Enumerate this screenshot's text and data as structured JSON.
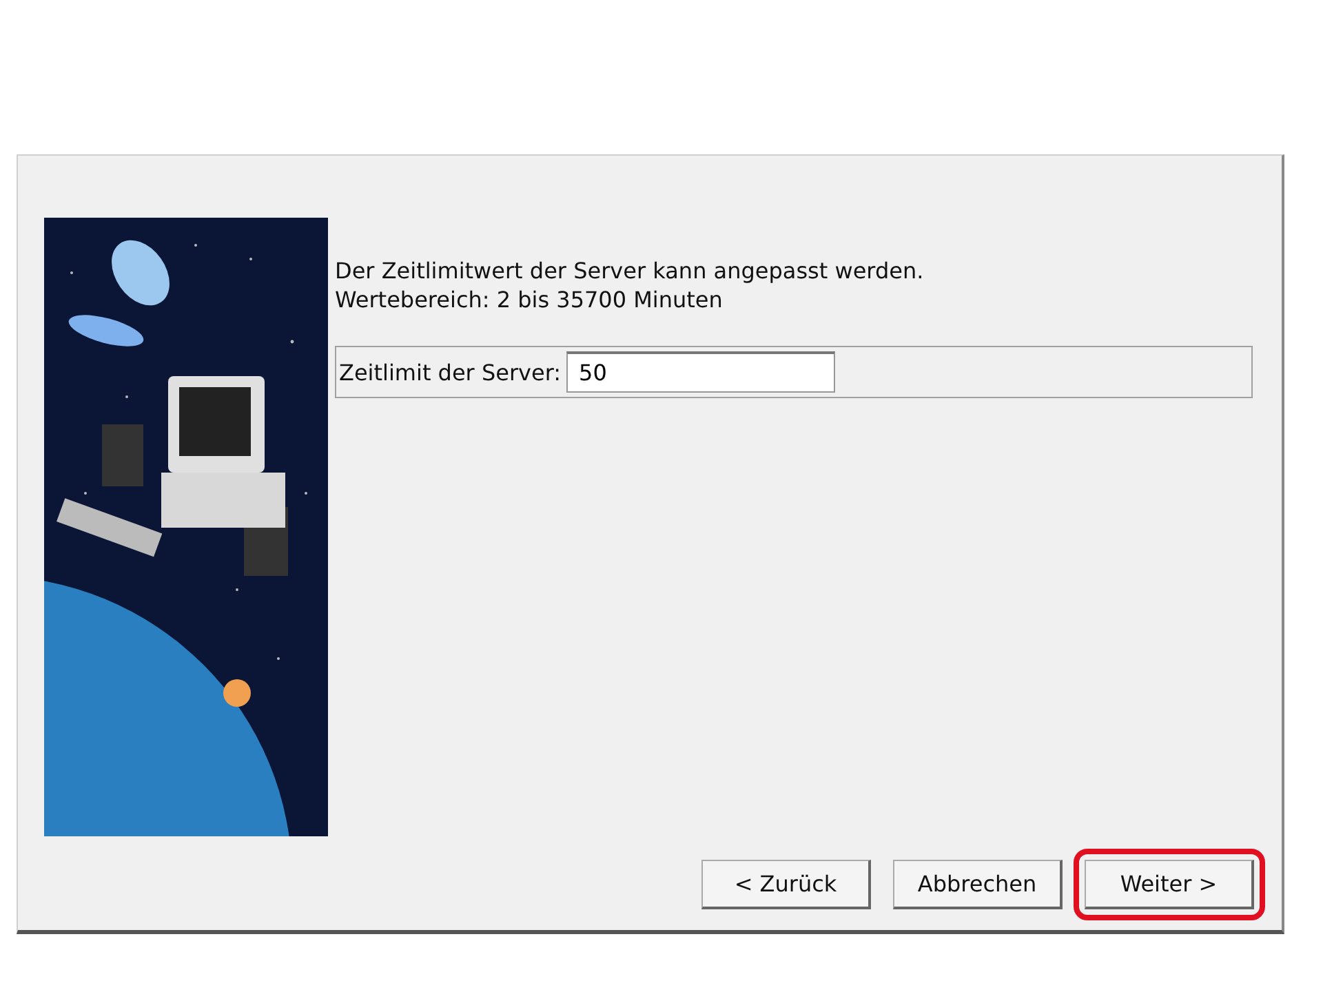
{
  "intro": [
    "Der Zeitlimitwert der Server kann angepasst werden.",
    "Wertebereich: 2 bis 35700 Minuten"
  ],
  "field": {
    "label": "Zeitlimit der Server:",
    "value": "50"
  },
  "buttons": [
    {
      "label": "< Zurück",
      "highlighted": false
    },
    {
      "label": "Abbrechen",
      "highlighted": false
    },
    {
      "label": "Weiter >",
      "highlighted": true
    }
  ]
}
